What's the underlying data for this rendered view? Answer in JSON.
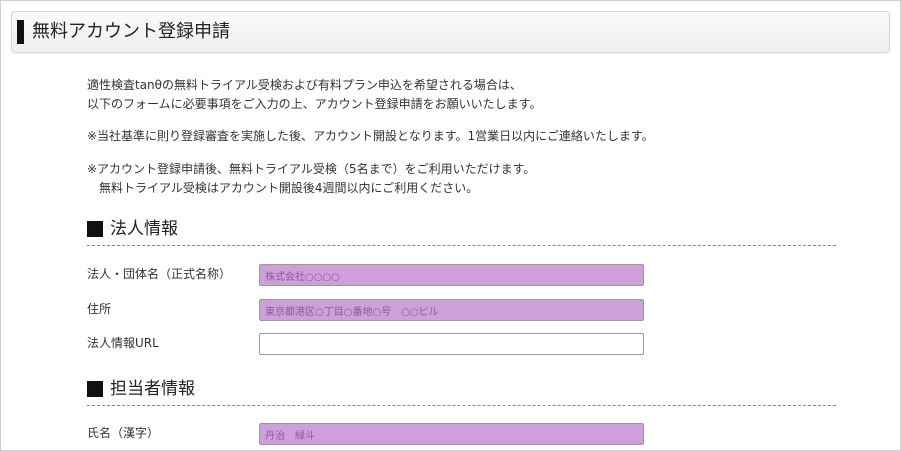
{
  "page": {
    "title": "無料アカウント登録申請"
  },
  "intro": {
    "line1": "適性検査tanθの無料トライアル受検および有料プラン申込を希望される場合は、",
    "line2": "以下のフォームに必要事項をご入力の上、アカウント登録申請をお願いいたします。",
    "note1": "※当社基準に則り登録審査を実施した後、アカウント開設となります。1営業日以内にご連絡いたします。",
    "note2_line1": "※アカウント登録申請後、無料トライアル受検（5名まで）をご利用いただけます。",
    "note2_line2": "無料トライアル受検はアカウント開設後4週間以内にご利用ください。"
  },
  "sections": {
    "corporate": {
      "title": "法人情報",
      "fields": {
        "company_name": {
          "label": "法人・団体名（正式名称）",
          "value": "株式会社○○○○"
        },
        "address": {
          "label": "住所",
          "value": "東京都港区○丁目○番地○号　○○ビル"
        },
        "url": {
          "label": "法人情報URL",
          "value": ""
        }
      }
    },
    "contact": {
      "title": "担当者情報",
      "fields": {
        "name_kanji": {
          "label": "氏名（漢字）",
          "value": "丹治　緑斗"
        }
      }
    }
  },
  "colors": {
    "filled_input": "#cf9fdc",
    "filled_text": "#8a5a96",
    "title_mark": "#111111"
  }
}
